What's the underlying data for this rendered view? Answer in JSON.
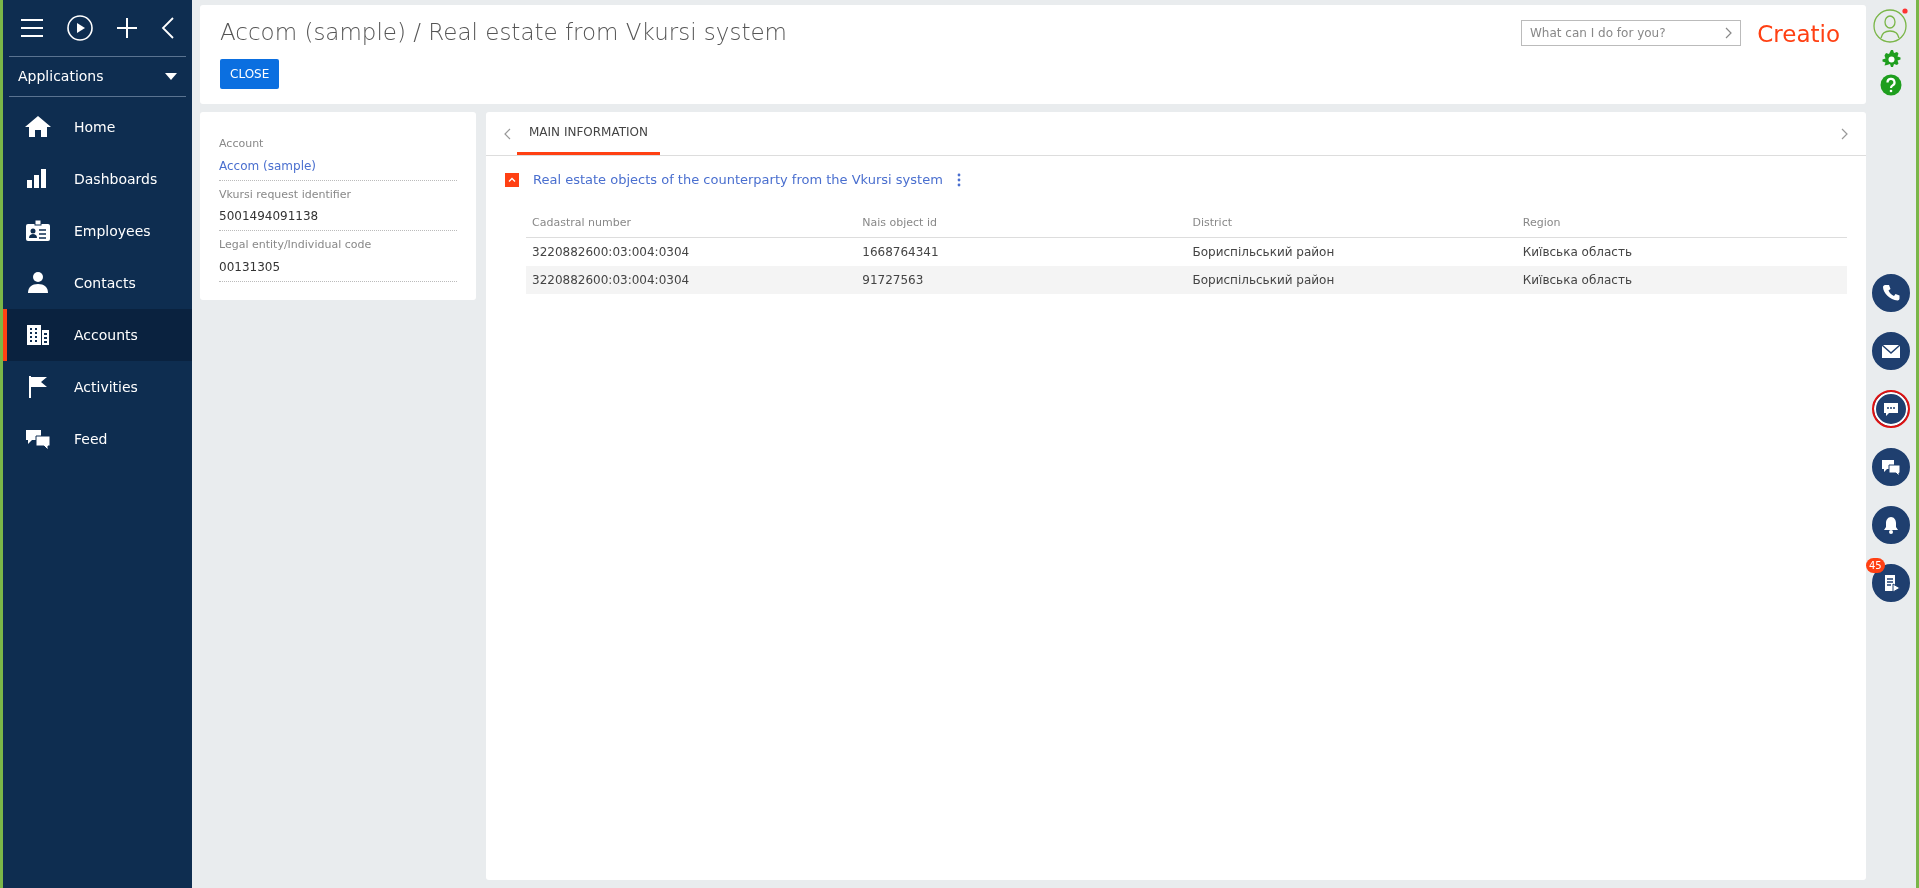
{
  "sidebar": {
    "apps_label": "Applications",
    "items": [
      {
        "label": "Home",
        "selected": false
      },
      {
        "label": "Dashboards",
        "selected": false
      },
      {
        "label": "Employees",
        "selected": false
      },
      {
        "label": "Contacts",
        "selected": false
      },
      {
        "label": "Accounts",
        "selected": true
      },
      {
        "label": "Activities",
        "selected": false
      },
      {
        "label": "Feed",
        "selected": false
      }
    ]
  },
  "header": {
    "title": "Accom (sample) / Real estate from Vkursi system",
    "close_button": "CLOSE",
    "search": {
      "placeholder": "What can I do for you?"
    },
    "logo": "Creatio"
  },
  "fields": [
    {
      "label": "Account",
      "value": "Accom (sample)",
      "kind": "link"
    },
    {
      "label": "Vkursi request identifier",
      "value": "5001494091138",
      "kind": "text"
    },
    {
      "label": "Legal entity/Individual code",
      "value": "00131305",
      "kind": "text"
    }
  ],
  "tabs": [
    {
      "label": "MAIN INFORMATION",
      "selected": true
    }
  ],
  "detail": {
    "title": "Real estate objects of the counterparty from the Vkursi system",
    "expanded": true,
    "columns": [
      "Cadastral number",
      "Nais object id",
      "District",
      "Region"
    ],
    "rows": [
      [
        "3220882600:03:004:0304",
        "1668764341",
        "Бориспільський район",
        "Київська область"
      ],
      [
        "3220882600:03:004:0304",
        "91727563",
        "Бориспільський район",
        "Київська область"
      ]
    ]
  },
  "right_bar": {
    "items": [
      {
        "selected": false
      },
      {
        "selected": false
      },
      {
        "selected": true
      },
      {
        "selected": false
      },
      {
        "selected": false
      },
      {
        "selected": false,
        "badge": "45"
      }
    ]
  }
}
